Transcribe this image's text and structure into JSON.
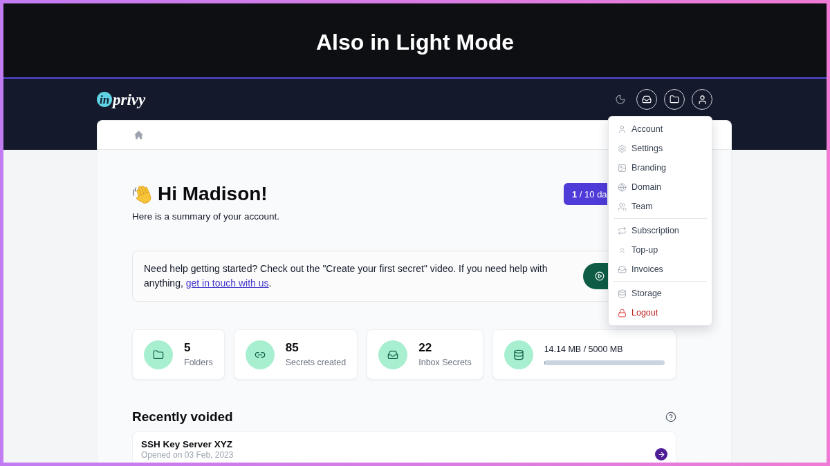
{
  "banner": {
    "title": "Also in Light Mode"
  },
  "logo": {
    "mark": "in",
    "name": "privy"
  },
  "user_menu": {
    "open": true,
    "groups": [
      [
        {
          "label": "Account",
          "kind": "normal"
        },
        {
          "label": "Settings",
          "kind": "normal"
        },
        {
          "label": "Branding",
          "kind": "normal"
        },
        {
          "label": "Domain",
          "kind": "normal"
        },
        {
          "label": "Team",
          "kind": "normal"
        }
      ],
      [
        {
          "label": "Subscription",
          "kind": "normal"
        },
        {
          "label": "Top-up",
          "kind": "normal"
        },
        {
          "label": "Invoices",
          "kind": "normal"
        }
      ],
      [
        {
          "label": "Storage",
          "kind": "normal"
        },
        {
          "label": "Logout",
          "kind": "danger"
        }
      ]
    ]
  },
  "greeting": {
    "title": "Hi Madison!",
    "subtitle": "Here is a summary of your account."
  },
  "trial_badge": {
    "text": "**1** / 10 da"
  },
  "help_notice": {
    "text": "Need help getting started? Check out the \"Create your first secret\" video. If you need help with anything, ",
    "link": "get in touch with us",
    "after": "."
  },
  "stats": [
    {
      "value": "5",
      "label": "Folders"
    },
    {
      "value": "85",
      "label": "Secrets created"
    },
    {
      "value": "22",
      "label": "Inbox Secrets"
    }
  ],
  "storage": {
    "reading": "14.14 MB / 5000 MB",
    "level": 0.003
  },
  "recently_voided": {
    "title": "Recently voided",
    "items": [
      {
        "name": "SSH Key Server XYZ",
        "date": "Opened on 03 Feb, 2023"
      }
    ]
  }
}
